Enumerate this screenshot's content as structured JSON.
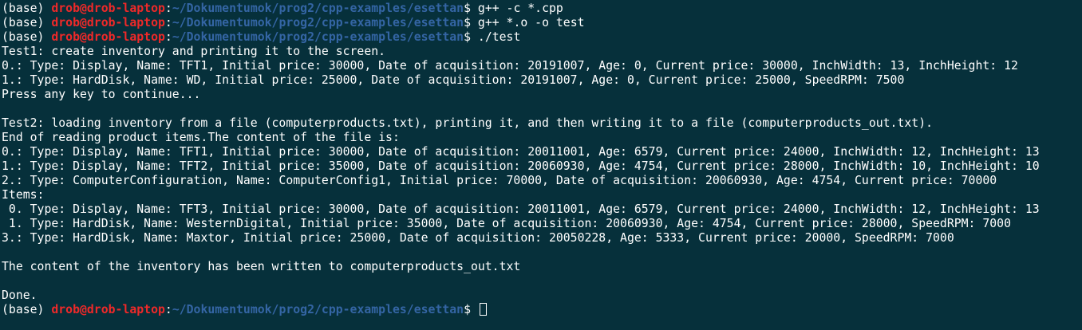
{
  "prompt": {
    "env": "(base) ",
    "user_host": "drob@drob-laptop",
    "separator": ":",
    "path": "~/Dokumentumok/prog2/cpp-examples/esettan",
    "symbol": "$ "
  },
  "commands": [
    "g++ -c *.cpp",
    "g++ *.o -o test",
    "./test"
  ],
  "output_lines": [
    "Test1: create inventory and printing it to the screen.",
    "0.: Type: Display, Name: TFT1, Initial price: 30000, Date of acquisition: 20191007, Age: 0, Current price: 30000, InchWidth: 13, InchHeight: 12",
    "1.: Type: HardDisk, Name: WD, Initial price: 25000, Date of acquisition: 20191007, Age: 0, Current price: 25000, SpeedRPM: 7500",
    "Press any key to continue...",
    "",
    "Test2: loading inventory from a file (computerproducts.txt), printing it, and then writing it to a file (computerproducts_out.txt).",
    "End of reading product items.The content of the file is:",
    "0.: Type: Display, Name: TFT1, Initial price: 30000, Date of acquisition: 20011001, Age: 6579, Current price: 24000, InchWidth: 12, InchHeight: 13",
    "1.: Type: Display, Name: TFT2, Initial price: 35000, Date of acquisition: 20060930, Age: 4754, Current price: 28000, InchWidth: 10, InchHeight: 10",
    "2.: Type: ComputerConfiguration, Name: ComputerConfig1, Initial price: 70000, Date of acquisition: 20060930, Age: 4754, Current price: 70000",
    "Items:",
    " 0. Type: Display, Name: TFT3, Initial price: 30000, Date of acquisition: 20011001, Age: 6579, Current price: 24000, InchWidth: 12, InchHeight: 13",
    " 1. Type: HardDisk, Name: WesternDigital, Initial price: 35000, Date of acquisition: 20060930, Age: 4754, Current price: 28000, SpeedRPM: 7000",
    "3.: Type: HardDisk, Name: Maxtor, Initial price: 25000, Date of acquisition: 20050228, Age: 5333, Current price: 20000, SpeedRPM: 7000",
    "",
    "The content of the inventory has been written to computerproducts_out.txt",
    "",
    "Done."
  ],
  "colors": {
    "background": "#06303b",
    "foreground": "#ffffff",
    "user_host": "#ef2929",
    "path": "#3465a4"
  }
}
